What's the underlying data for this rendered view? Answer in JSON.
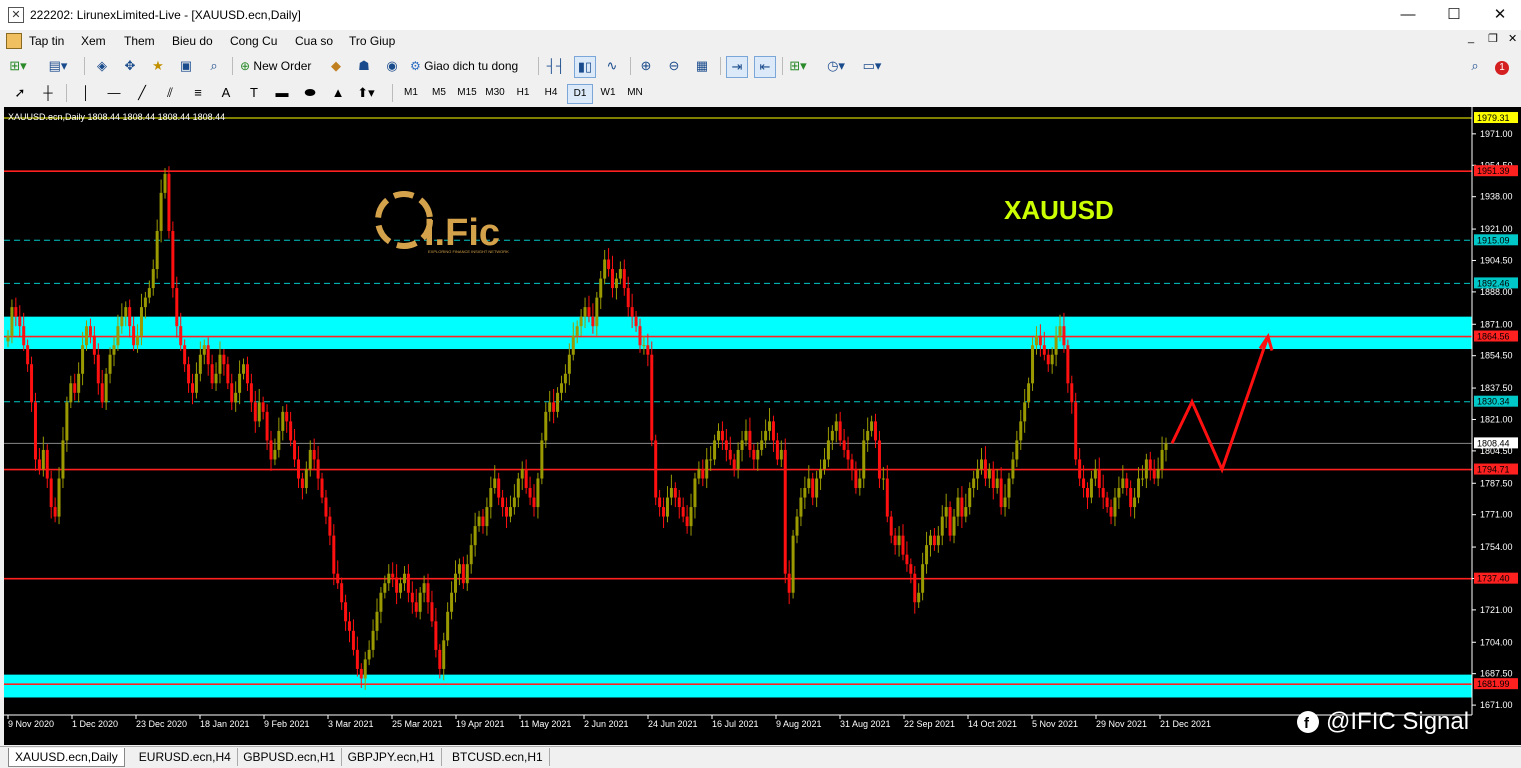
{
  "window": {
    "title": "222202: LirunexLimited-Live - [XAUUSD.ecn,Daily]",
    "app_icon": "chart-app-icon"
  },
  "menu": {
    "items": [
      "Tap tin",
      "Xem",
      "Them",
      "Bieu do",
      "Cong Cu",
      "Cua so",
      "Tro Giup"
    ]
  },
  "toolbar": {
    "new_order_label": "New Order",
    "auto_trade_label": "Giao dich tu dong",
    "notification_count": "1"
  },
  "timeframes": {
    "items": [
      "M1",
      "M5",
      "M15",
      "M30",
      "H1",
      "H4",
      "D1",
      "W1",
      "MN"
    ],
    "active": "D1"
  },
  "chart": {
    "header": "XAUUSD.ecn,Daily  1808.44 1808.44 1808.44 1808.44",
    "symbol_label": "XAUUSD",
    "logo_text": "I.Fic",
    "logo_subtext": "EXPLORING FINANCE INSIGHT NETWORK",
    "watermark": "@IFIC Signal"
  },
  "chart_data": {
    "type": "candlestick",
    "symbol": "XAUUSD.ecn",
    "timeframe": "Daily",
    "ylim": [
      1670,
      1983
    ],
    "y_ticks": [
      1971.0,
      1954.5,
      1938.0,
      1921.0,
      1904.5,
      1888.0,
      1871.0,
      1854.5,
      1837.5,
      1821.0,
      1804.5,
      1787.5,
      1771.0,
      1754.0,
      1737.5,
      1721.0,
      1704.0,
      1687.5,
      1671.0
    ],
    "x_labels": [
      "9 Nov 2020",
      "1 Dec 2020",
      "23 Dec 2020",
      "18 Jan 2021",
      "9 Feb 2021",
      "3 Mar 2021",
      "25 Mar 2021",
      "19 Apr 2021",
      "11 May 2021",
      "2 Jun 2021",
      "24 Jun 2021",
      "16 Jul 2021",
      "9 Aug 2021",
      "31 Aug 2021",
      "22 Sep 2021",
      "14 Oct 2021",
      "5 Nov 2021",
      "29 Nov 2021",
      "21 Dec 2021"
    ],
    "current_price": 1808.44,
    "price_labels": [
      {
        "value": 1979.31,
        "text": "1979.31",
        "color": "#ffff00"
      },
      {
        "value": 1951.39,
        "text": "1951.39",
        "color": "#ff2020"
      },
      {
        "value": 1915.09,
        "text": "1915.09",
        "color": "#00c8c8"
      },
      {
        "value": 1892.46,
        "text": "1892.46",
        "color": "#00c8c8"
      },
      {
        "value": 1864.56,
        "text": "1864.56",
        "color": "#ff2020"
      },
      {
        "value": 1830.34,
        "text": "1830.34",
        "color": "#00c8c8"
      },
      {
        "value": 1808.44,
        "text": "1808.44",
        "color": "#ffffff"
      },
      {
        "value": 1794.71,
        "text": "1794.71",
        "color": "#ff2020"
      },
      {
        "value": 1737.4,
        "text": "1737.40",
        "color": "#ff2020"
      },
      {
        "value": 1681.99,
        "text": "1681.99",
        "color": "#ff2020"
      }
    ],
    "support_resistance_lines": [
      1951.39,
      1864.56,
      1794.71,
      1737.4,
      1681.99
    ],
    "dashed_levels": [
      1915.09,
      1892.46,
      1830.34
    ],
    "zones": [
      {
        "from": 1858,
        "to": 1875
      },
      {
        "from": 1675,
        "to": 1687
      }
    ],
    "series": [
      {
        "close": [
          1865,
          1880,
          1875,
          1870,
          1860,
          1850,
          1830,
          1800,
          1795,
          1805,
          1790,
          1775,
          1770,
          1790,
          1810,
          1830,
          1840,
          1835,
          1845,
          1860,
          1870,
          1865,
          1855,
          1840,
          1830,
          1845,
          1855,
          1860,
          1870,
          1875,
          1880,
          1870,
          1860,
          1865,
          1880,
          1885,
          1890,
          1900,
          1920,
          1940,
          1950,
          1920,
          1890,
          1870,
          1860,
          1850,
          1840,
          1835,
          1845,
          1855,
          1860,
          1850,
          1840,
          1845,
          1855,
          1850,
          1840,
          1830,
          1835,
          1845,
          1850,
          1840,
          1830,
          1820,
          1830,
          1825,
          1810,
          1800,
          1805,
          1815,
          1825,
          1820,
          1810,
          1800,
          1790,
          1785,
          1795,
          1805,
          1800,
          1790,
          1780,
          1770,
          1760,
          1740,
          1735,
          1725,
          1715,
          1710,
          1700,
          1690,
          1685,
          1695,
          1700,
          1710,
          1720,
          1730,
          1735,
          1740,
          1738,
          1730,
          1735,
          1740,
          1730,
          1725,
          1720,
          1730,
          1735,
          1725,
          1715,
          1700,
          1690,
          1705,
          1720,
          1730,
          1740,
          1745,
          1735,
          1745,
          1755,
          1765,
          1770,
          1765,
          1775,
          1785,
          1790,
          1780,
          1775,
          1770,
          1775,
          1780,
          1790,
          1795,
          1785,
          1780,
          1775,
          1790,
          1810,
          1825,
          1830,
          1825,
          1835,
          1840,
          1845,
          1855,
          1865,
          1870,
          1875,
          1880,
          1875,
          1870,
          1885,
          1895,
          1905,
          1900,
          1890,
          1895,
          1900,
          1890,
          1880,
          1875,
          1870,
          1860,
          1860,
          1855,
          1810,
          1780,
          1775,
          1770,
          1780,
          1785,
          1780,
          1775,
          1770,
          1765,
          1775,
          1790,
          1795,
          1790,
          1800,
          1800,
          1810,
          1815,
          1810,
          1805,
          1800,
          1795,
          1805,
          1810,
          1815,
          1805,
          1800,
          1805,
          1810,
          1815,
          1820,
          1810,
          1800,
          1805,
          1740,
          1730,
          1760,
          1770,
          1780,
          1785,
          1790,
          1780,
          1790,
          1795,
          1800,
          1810,
          1815,
          1820,
          1810,
          1805,
          1800,
          1795,
          1785,
          1790,
          1810,
          1815,
          1820,
          1810,
          1790,
          1790,
          1770,
          1760,
          1755,
          1760,
          1750,
          1745,
          1740,
          1725,
          1730,
          1745,
          1755,
          1760,
          1755,
          1760,
          1770,
          1775,
          1760,
          1770,
          1780,
          1770,
          1775,
          1785,
          1790,
          1795,
          1800,
          1790,
          1795,
          1785,
          1790,
          1775,
          1780,
          1790,
          1800,
          1810,
          1820,
          1830,
          1840,
          1860,
          1865,
          1860,
          1855,
          1850,
          1855,
          1865,
          1870,
          1860,
          1840,
          1830,
          1800,
          1790,
          1785,
          1780,
          1790,
          1795,
          1785,
          1780,
          1775,
          1770,
          1780,
          1785,
          1790,
          1785,
          1775,
          1780,
          1790,
          1790,
          1800,
          1795,
          1790,
          1795,
          1805,
          1808.44
        ]
      }
    ]
  },
  "arrow_projection": [
    1808.44,
    1830.34,
    1794.71,
    1864.56
  ],
  "tabs": {
    "items": [
      "XAUUSD.ecn,Daily",
      "EURUSD.ecn,H4",
      "GBPUSD.ecn,H1",
      "GBPJPY.ecn,H1",
      "BTCUSD.ecn,H1"
    ],
    "active": 0
  },
  "colors": {
    "bull": "#9a9a00",
    "bear": "#ff1010",
    "zone": "#00ffff",
    "level": "#ff2020",
    "dashed": "#00c8c8",
    "symbol": "#ccff00",
    "logo": "#d4a24a"
  }
}
